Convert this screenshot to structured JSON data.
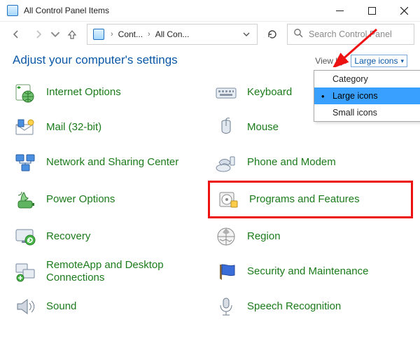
{
  "window": {
    "title": "All Control Panel Items"
  },
  "breadcrumb": {
    "part1": "Cont...",
    "part2": "All Con..."
  },
  "search": {
    "placeholder": "Search Control Panel"
  },
  "header": {
    "title": "Adjust your computer's settings",
    "viewby_label": "View by:",
    "viewby_value": "Large icons"
  },
  "dropdown": {
    "options": [
      {
        "label": "Category",
        "selected": false
      },
      {
        "label": "Large icons",
        "selected": true
      },
      {
        "label": "Small icons",
        "selected": false
      }
    ]
  },
  "items_left": [
    {
      "label": "Internet Options"
    },
    {
      "label": "Mail (32-bit)"
    },
    {
      "label": "Network and Sharing Center"
    },
    {
      "label": "Power Options"
    },
    {
      "label": "Recovery"
    },
    {
      "label": "RemoteApp and Desktop Connections"
    },
    {
      "label": "Sound"
    }
  ],
  "items_right": [
    {
      "label": "Keyboard"
    },
    {
      "label": "Mouse"
    },
    {
      "label": "Phone and Modem"
    },
    {
      "label": "Programs and Features",
      "highlight": true
    },
    {
      "label": "Region"
    },
    {
      "label": "Security and Maintenance"
    },
    {
      "label": "Speech Recognition"
    }
  ],
  "colors": {
    "link": "#1b7b1b",
    "accent": "#0a58a6",
    "highlight_border": "#e11"
  }
}
